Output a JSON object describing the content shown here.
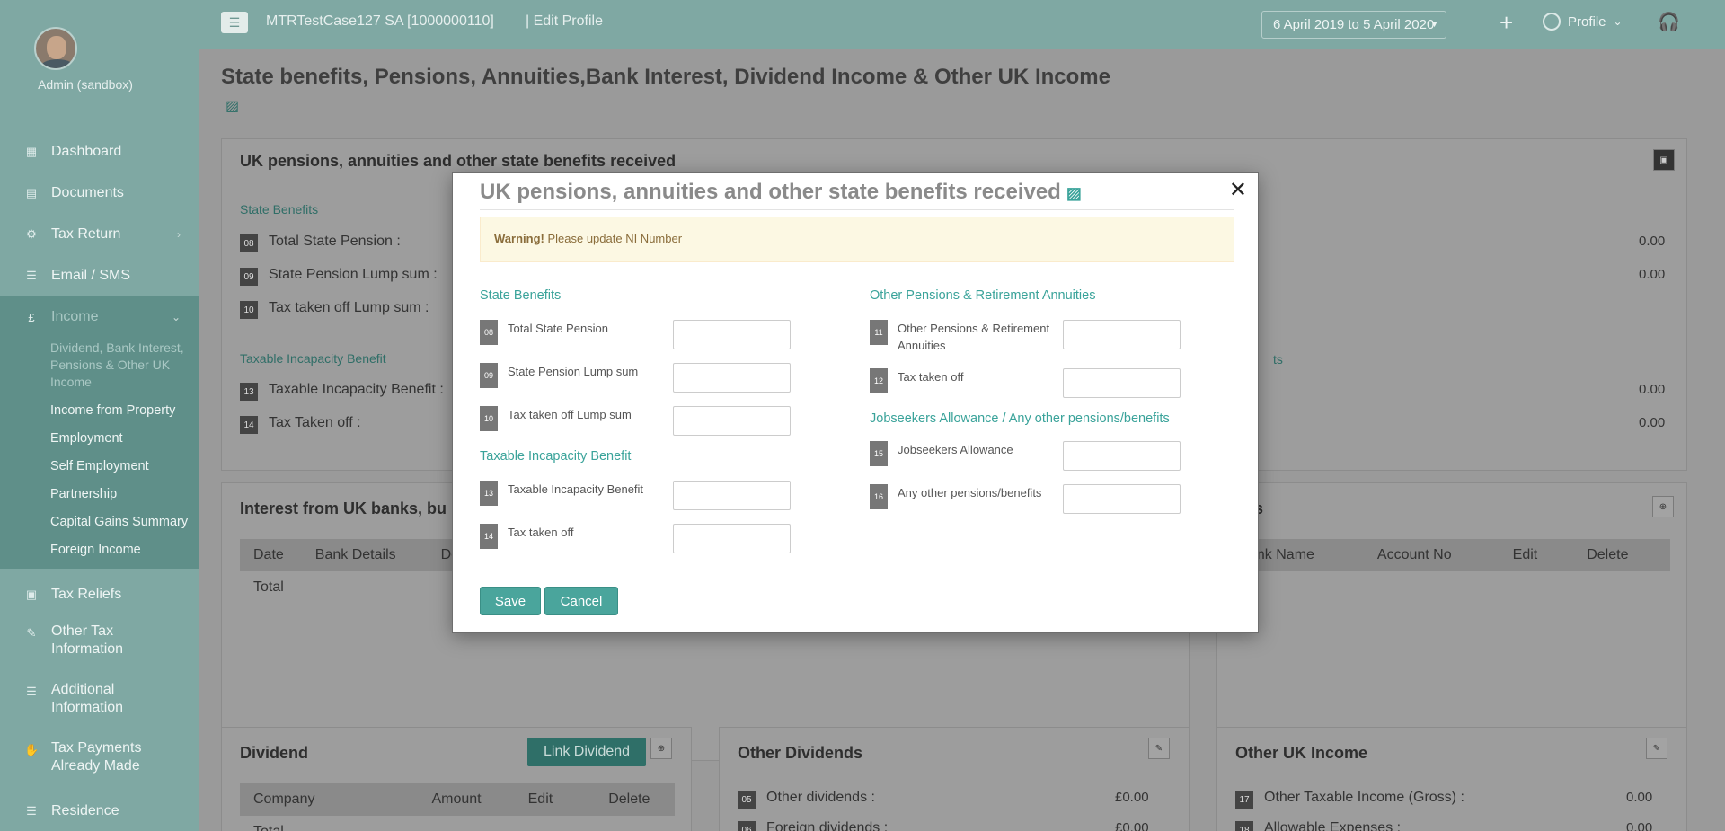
{
  "user": {
    "name": "Admin (sandbox)"
  },
  "sidebar": {
    "items": [
      {
        "label": "Dashboard",
        "icon": "grid-icon"
      },
      {
        "label": "Documents",
        "icon": "folder-icon"
      },
      {
        "label": "Tax Return",
        "icon": "sliders-icon"
      },
      {
        "label": "Email / SMS",
        "icon": "list-icon"
      },
      {
        "label": "Income",
        "icon": "pound-icon"
      }
    ],
    "income_submenu": [
      "Dividend, Bank Interest, Pensions & Other UK Income",
      "Income from Property",
      "Employment",
      "Self Employment",
      "Partnership",
      "Capital Gains Summary",
      "Foreign Income"
    ],
    "lower_items": [
      {
        "label": "Tax Reliefs",
        "icon": "calculator-icon"
      },
      {
        "label": "Other Tax Information",
        "icon": "note-icon"
      },
      {
        "label": "Additional Information",
        "icon": "list-icon"
      },
      {
        "label": "Tax Payments Already Made",
        "icon": "payment-icon"
      },
      {
        "label": "Residence",
        "icon": "list-icon"
      }
    ]
  },
  "header": {
    "client": "MTRTestCase127 SA [1000000110]",
    "crumb": "| Edit Profile",
    "period": "6 April 2019 to 5 April 2020",
    "profile": "Profile"
  },
  "page": {
    "title": "State benefits, Pensions, Annuities,Bank Interest, Dividend Income & Other UK Income",
    "pensions_panel": {
      "title": "UK pensions, annuities and other state benefits received",
      "state_benefits": "State Benefits",
      "rows": [
        {
          "num": "08",
          "label": "Total State Pension :"
        },
        {
          "num": "09",
          "label": "State Pension Lump sum :"
        },
        {
          "num": "10",
          "label": "Tax taken off Lump sum :"
        }
      ],
      "incapacity": "Taxable Incapacity Benefit",
      "rows2": [
        {
          "num": "13",
          "label": "Taxable Incapacity Benefit :"
        },
        {
          "num": "14",
          "label": "Tax Taken off :"
        }
      ],
      "values": [
        "0.00",
        "0.00",
        "0.00",
        "0.00"
      ],
      "right_section_fragment": "ts"
    },
    "interest_panel": {
      "title": "Interest from UK banks, bu",
      "cols": [
        "Date",
        "Bank Details",
        "Des"
      ],
      "total": "Total",
      "right_title_fragment": "nks",
      "right_cols": [
        "ank Name",
        "Account No",
        "Edit",
        "Delete"
      ]
    },
    "dividend_panel": {
      "title": "Dividend",
      "link": "Link Dividend",
      "cols": [
        "Company",
        "Amount",
        "Edit",
        "Delete"
      ],
      "total": "Total"
    },
    "other_dividends": {
      "title": "Other Dividends",
      "rows": [
        {
          "num": "05",
          "label": "Other dividends :",
          "value": "£0.00"
        },
        {
          "num": "06",
          "label": "Foreign dividends :",
          "value": "£0.00"
        }
      ]
    },
    "other_uk_income": {
      "title": "Other UK Income",
      "rows": [
        {
          "num": "17",
          "label": "Other Taxable Income (Gross) :",
          "value": "0.00"
        },
        {
          "num": "18",
          "label": "Allowable Expenses :",
          "value": "0.00"
        }
      ]
    }
  },
  "modal": {
    "title": "UK pensions, annuities and other state benefits received",
    "warning_strong": "Warning!",
    "warning_text": " Please update NI Number",
    "left": {
      "state_benefits": "State Benefits",
      "rows": [
        {
          "num": "08",
          "label": "Total State Pension"
        },
        {
          "num": "09",
          "label": "State Pension Lump sum"
        },
        {
          "num": "10",
          "label": "Tax taken off Lump sum"
        }
      ],
      "incapacity": "Taxable Incapacity Benefit",
      "rows2": [
        {
          "num": "13",
          "label": "Taxable Incapacity Benefit"
        },
        {
          "num": "14",
          "label": "Tax taken off"
        }
      ]
    },
    "right": {
      "other_pensions": "Other Pensions & Retirement Annuities",
      "rows": [
        {
          "num": "11",
          "label": "Other Pensions & Retirement Annuities"
        },
        {
          "num": "12",
          "label": "Tax taken off"
        }
      ],
      "jobseekers": "Jobseekers Allowance / Any other pensions/benefits",
      "rows2": [
        {
          "num": "15",
          "label": "Jobseekers Allowance"
        },
        {
          "num": "16",
          "label": "Any other pensions/benefits"
        }
      ]
    },
    "save": "Save",
    "cancel": "Cancel"
  }
}
